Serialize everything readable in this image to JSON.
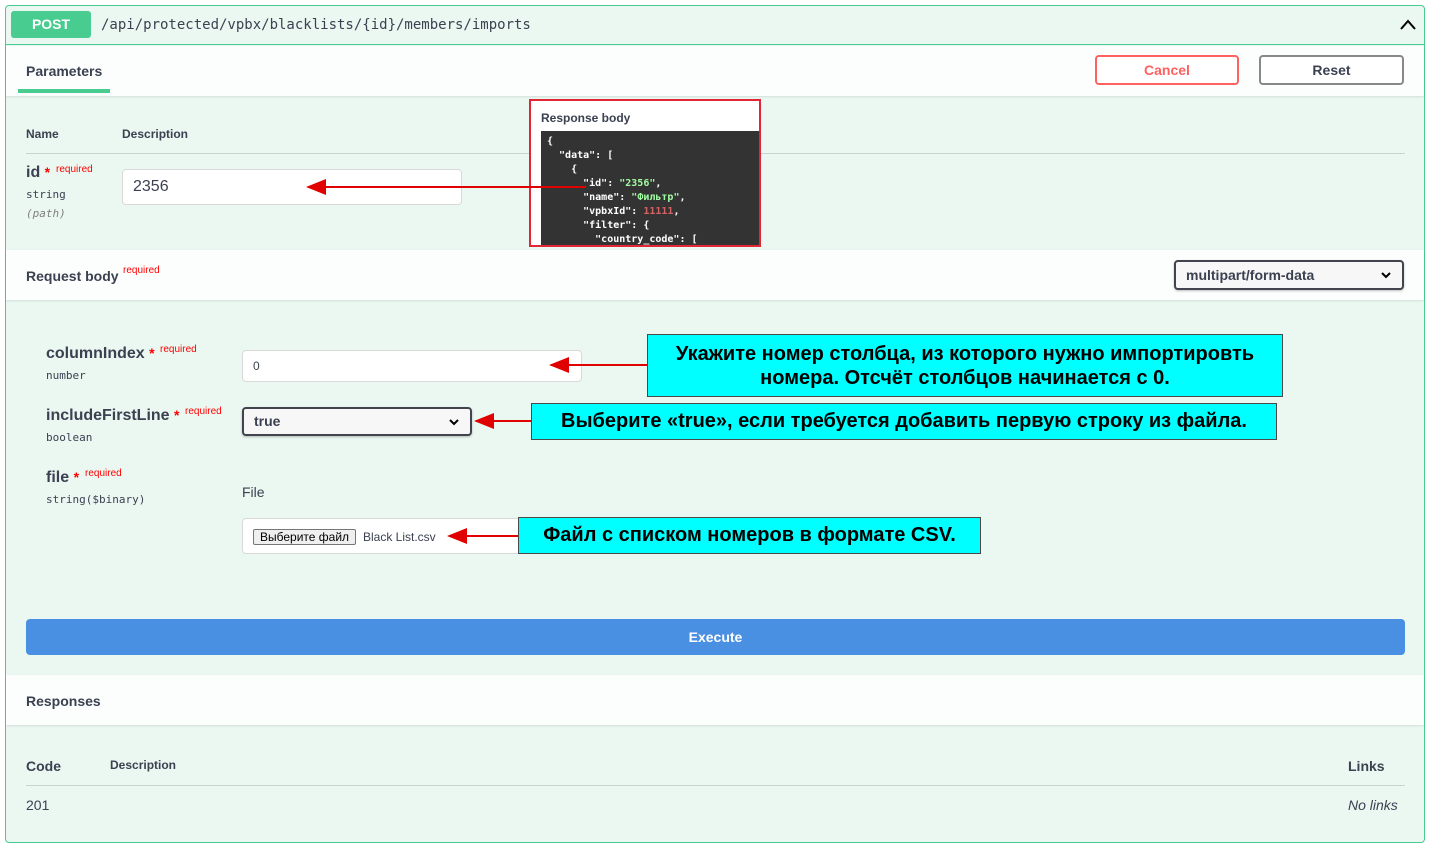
{
  "summary": {
    "method": "POST",
    "path": "/api/protected/vpbx/blacklists/{id}/members/imports"
  },
  "toolbar": {
    "tab_parameters": "Parameters",
    "cancel_label": "Cancel",
    "reset_label": "Reset"
  },
  "parameters": {
    "col_name": "Name",
    "col_description": "Description",
    "id_param": {
      "name": "id",
      "star": "*",
      "required": "required",
      "type": "string",
      "in": "(path)",
      "value": "2356"
    }
  },
  "request_body": {
    "title": "Request body",
    "required": "required",
    "content_type": "multipart/form-data",
    "column_index": {
      "name": "columnIndex",
      "star": "*",
      "required": "required",
      "type": "number",
      "value": "0"
    },
    "include_first_line": {
      "name": "includeFirstLine",
      "star": "*",
      "required": "required",
      "type": "boolean",
      "value": "true"
    },
    "file": {
      "name": "file",
      "star": "*",
      "required": "required",
      "type": "string($binary)",
      "description": "File",
      "button_label": "Выберите файл",
      "file_name": "Black List.csv"
    }
  },
  "callouts": {
    "column_index": "Укажите номер столбца, из которого нужно импортировть номера. Отсчёт столбцов начинается с 0.",
    "include_first_line": "Выберите «true», если требуется добавить первую строку из файла.",
    "file": "Файл с списком номеров в формате CSV."
  },
  "response_body_popup": {
    "title": "Response body",
    "lines": [
      "{",
      "  \"data\": [",
      "    {",
      "      \"id\": ",
      "      \"name\": ",
      "      \"vpbxId\": ",
      "      \"filter\": {",
      "        \"country_code\": ["
    ],
    "id_value": "\"2356\"",
    "name_value": "\"Фильтр\"",
    "vpbx_value": "11111"
  },
  "execute_label": "Execute",
  "responses": {
    "title": "Responses",
    "col_code": "Code",
    "col_description": "Description",
    "col_links": "Links",
    "rows": [
      {
        "code": "201",
        "description": "",
        "links": "No links"
      }
    ]
  },
  "colors": {
    "post_green": "#49cc90",
    "execute_blue": "#4990e2",
    "required_red": "#ff0000",
    "callout_cyan": "#00ffff",
    "arrow_red": "#e00000"
  }
}
